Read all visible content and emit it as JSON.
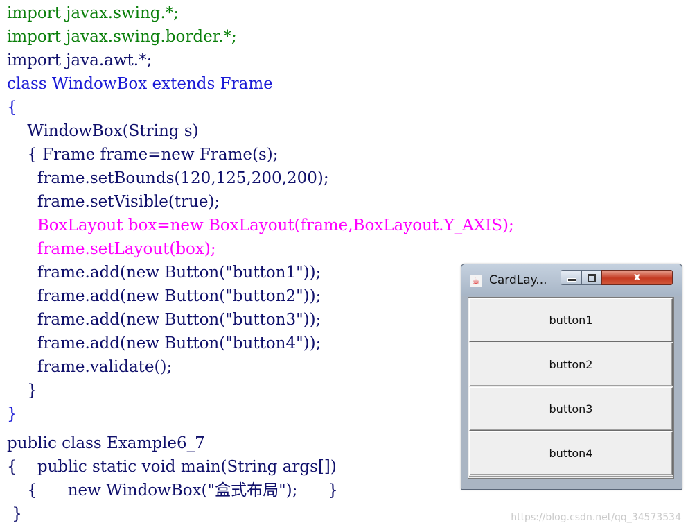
{
  "code": {
    "lines": [
      "import javax.swing.*;",
      "import javax.swing.border.*;",
      "import java.awt.*;",
      "class WindowBox extends Frame",
      "{",
      "    WindowBox(String s)",
      "    { Frame frame=new Frame(s);",
      "      frame.setBounds(120,125,200,200);",
      "      frame.setVisible(true);",
      "      BoxLayout box=new BoxLayout(frame,BoxLayout.Y_AXIS);",
      "      frame.setLayout(box);",
      "      frame.add(new Button(\"button1\"));",
      "      frame.add(new Button(\"button2\"));",
      "      frame.add(new Button(\"button3\"));",
      "      frame.add(new Button(\"button4\"));",
      "      frame.validate();",
      "    }",
      "}",
      "public class Example6_7",
      "{    public static void main(String args[])",
      "    {      new WindowBox(\"盒式布局\");      }",
      " }"
    ],
    "colors": {
      "import": "#0a7f0a",
      "class_decl": "#1a1ad6",
      "body": "#10106b",
      "highlight": "#ff00ff"
    }
  },
  "window": {
    "title": "CardLay...",
    "app_icon": "java-cup-icon",
    "close_glyph": "x",
    "buttons": [
      {
        "label": "button1"
      },
      {
        "label": "button2"
      },
      {
        "label": "button3"
      },
      {
        "label": "button4"
      }
    ]
  },
  "watermark": "https://blog.csdn.net/qq_34573534"
}
